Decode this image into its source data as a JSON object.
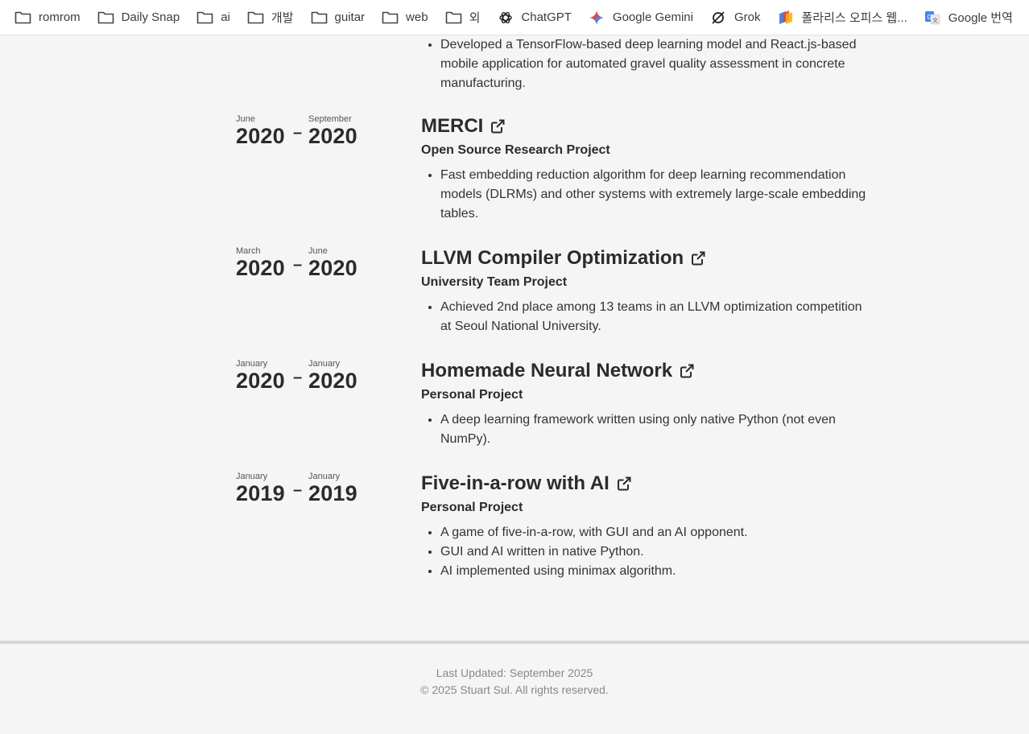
{
  "bookmarks": [
    {
      "label": "romrom",
      "icon": "folder-icon"
    },
    {
      "label": "Daily Snap",
      "icon": "folder-icon"
    },
    {
      "label": "ai",
      "icon": "folder-icon"
    },
    {
      "label": "개발",
      "icon": "folder-icon"
    },
    {
      "label": "guitar",
      "icon": "folder-icon"
    },
    {
      "label": "web",
      "icon": "folder-icon"
    },
    {
      "label": "외",
      "icon": "folder-icon"
    },
    {
      "label": "ChatGPT",
      "icon": "chatgpt-icon"
    },
    {
      "label": "Google Gemini",
      "icon": "gemini-icon"
    },
    {
      "label": "Grok",
      "icon": "grok-icon"
    },
    {
      "label": "폴라리스 오피스 웹...",
      "icon": "polaris-icon"
    },
    {
      "label": "Google 번역",
      "icon": "google-translate-icon"
    }
  ],
  "top_partial": {
    "bullets": [
      "Developed a TensorFlow-based deep learning model and React.js-based mobile application for automated gravel quality assessment in concrete manufacturing."
    ]
  },
  "projects": [
    {
      "start_month": "June",
      "start_year": "2020",
      "end_month": "September",
      "end_year": "2020",
      "title": "MERCI",
      "subtitle": "Open Source Research Project",
      "bullets": [
        "Fast embedding reduction algorithm for deep learning recommendation models (DLRMs) and other systems with extremely large-scale embedding tables."
      ]
    },
    {
      "start_month": "March",
      "start_year": "2020",
      "end_month": "June",
      "end_year": "2020",
      "title": "LLVM Compiler Optimization",
      "subtitle": "University Team Project",
      "bullets": [
        "Achieved 2nd place among 13 teams in an LLVM optimization competition at Seoul National University."
      ]
    },
    {
      "start_month": "January",
      "start_year": "2020",
      "end_month": "January",
      "end_year": "2020",
      "title": "Homemade Neural Network",
      "subtitle": "Personal Project",
      "bullets": [
        "A deep learning framework written using only native Python (not even NumPy)."
      ]
    },
    {
      "start_month": "January",
      "start_year": "2019",
      "end_month": "January",
      "end_year": "2019",
      "title": "Five-in-a-row with AI",
      "subtitle": "Personal Project",
      "bullets": [
        "A game of five-in-a-row, with GUI and an AI opponent.",
        "GUI and AI written in native Python.",
        "AI implemented using minimax algorithm."
      ]
    }
  ],
  "date_separator": "–",
  "footer": {
    "last_updated": "Last Updated: September 2025",
    "copyright": "© 2025 Stuart Sul. All rights reserved."
  }
}
